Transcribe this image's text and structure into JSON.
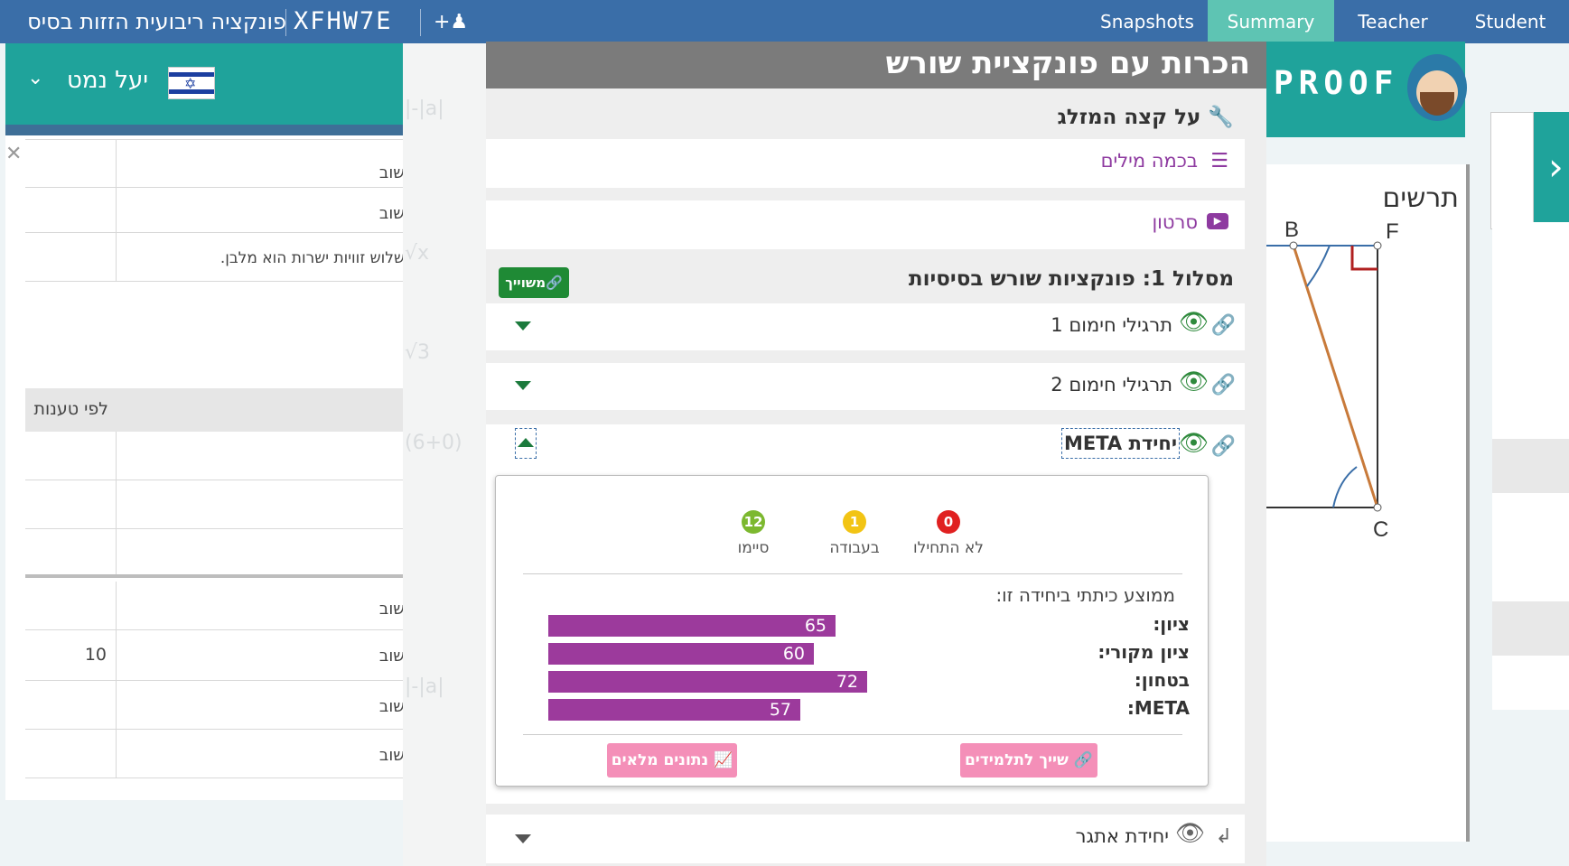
{
  "topbar": {
    "title": "פונקציה ריבועית הזזות בסיס",
    "code": "XFHW7E",
    "add_user_icon": "add-user-icon",
    "tabs": [
      {
        "label": "Snapshots",
        "active": false
      },
      {
        "label": "Summary",
        "active": true
      },
      {
        "label": "Teacher",
        "active": false
      },
      {
        "label": "Student",
        "active": false
      }
    ]
  },
  "left_panel": {
    "user_name": "יעל נמט",
    "flag_icon": "israel-flag-icon",
    "rows_top": [
      {
        "text": "שוב",
        "value": ""
      },
      {
        "text": "שוב",
        "value": ""
      },
      {
        "text": "שלוש זוויות ישרות הוא מלבן.",
        "value": ""
      }
    ],
    "section_header": "לפי טענות",
    "rows_bottom": [
      {
        "text": "שוב",
        "value": ""
      },
      {
        "text": "שוב",
        "value": "10"
      },
      {
        "text": "שוב",
        "value": ""
      },
      {
        "text": "שוב",
        "value": ""
      }
    ]
  },
  "center": {
    "title": "הכרות עם פונקציית שורש",
    "section_title": "על קצה המזלג",
    "links": [
      {
        "label": "בכמה מילים",
        "icon": "reading-icon"
      },
      {
        "label": "סרטון",
        "icon": "video-icon"
      }
    ],
    "track_title": "מסלול 1: פונקציות שורש בסיסיות",
    "assigned_badge": "משוייך",
    "units": [
      {
        "label": "תרגילי חימום 1"
      },
      {
        "label": "תרגילי חימום 2"
      },
      {
        "label": "יחידת META"
      }
    ],
    "last_unit": "יחידת אתגר",
    "popup": {
      "status": [
        {
          "count": "0",
          "label": "לא התחילו",
          "color": "#e02020"
        },
        {
          "count": "1",
          "label": "בעבודה",
          "color": "#f2c414"
        },
        {
          "count": "12",
          "label": "סיימו",
          "color": "#7cb82f"
        }
      ],
      "avg_title": "ממוצע כיתתי ביחידה זו:",
      "bars": [
        {
          "label": "ציון:",
          "value": 65
        },
        {
          "label": "ציון מקורי:",
          "value": 60
        },
        {
          "label": "בטחון:",
          "value": 72
        },
        {
          "label": "META:",
          "value": 57
        }
      ],
      "assign_button": "שייך לתלמידים",
      "data_button": "נתונים מלאים"
    }
  },
  "right_panel": {
    "logo_text": "PROOF",
    "sketch_title": "תרשים",
    "points": {
      "b": "B",
      "f": "F",
      "c": "C"
    }
  }
}
